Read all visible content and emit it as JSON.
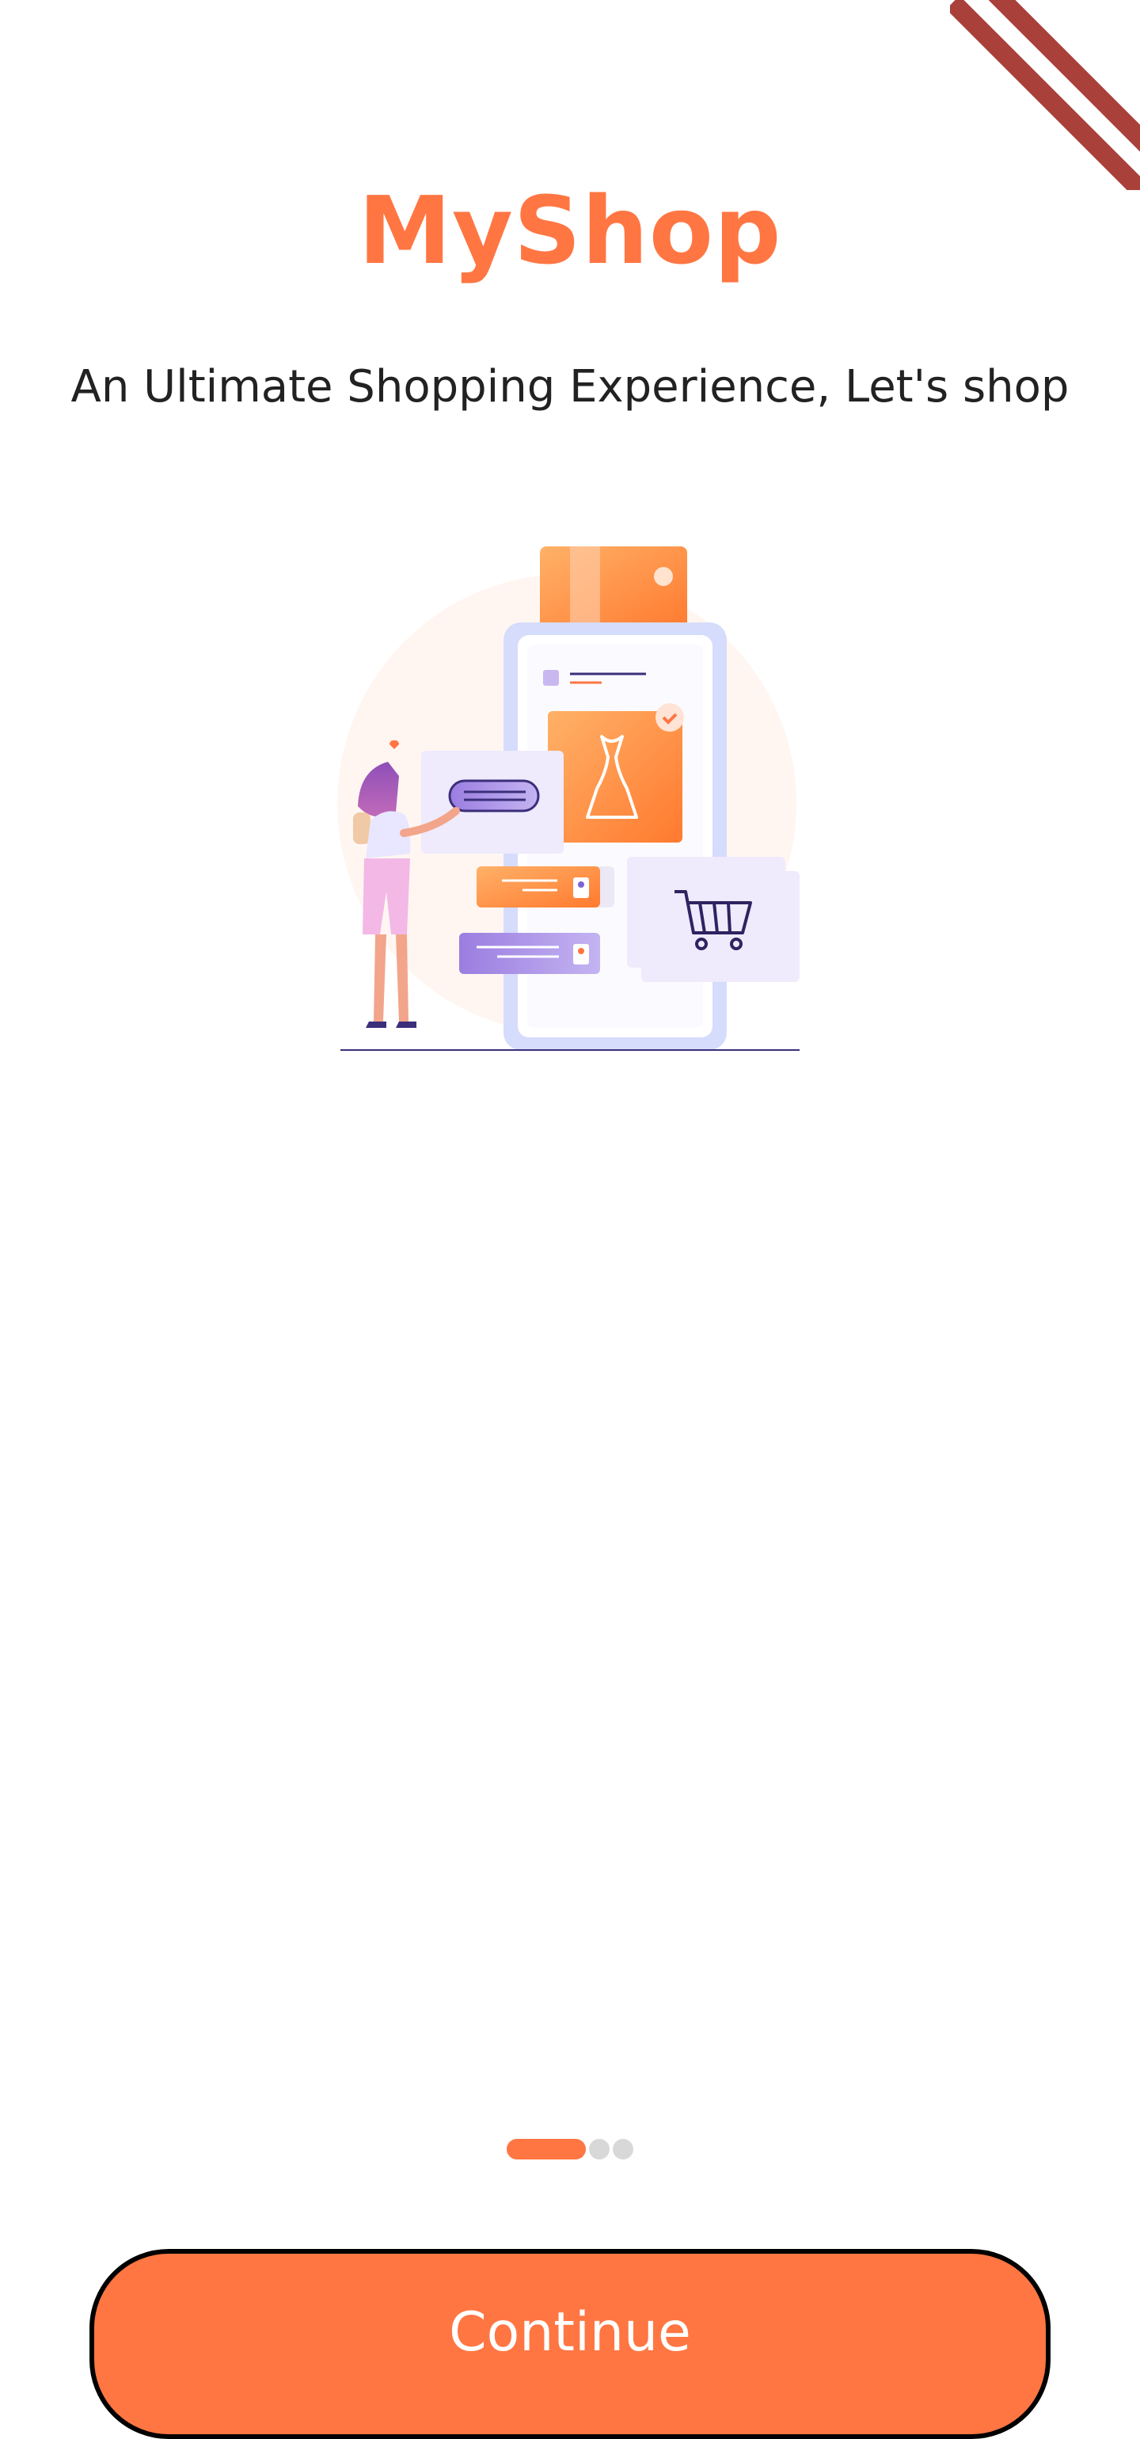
{
  "app": {
    "title": "MyShop",
    "tagline": "An Ultimate Shopping Experience, Let's shop"
  },
  "illustration": {
    "icon": "shopping-woman-phone-illustration"
  },
  "pager": {
    "count": 3,
    "active_index": 0
  },
  "actions": {
    "continue_label": "Continue"
  },
  "colors": {
    "accent": "#ff7643",
    "text": "#222222",
    "dot_inactive": "#d8d8d8",
    "debug_banner": "#a9403a"
  }
}
